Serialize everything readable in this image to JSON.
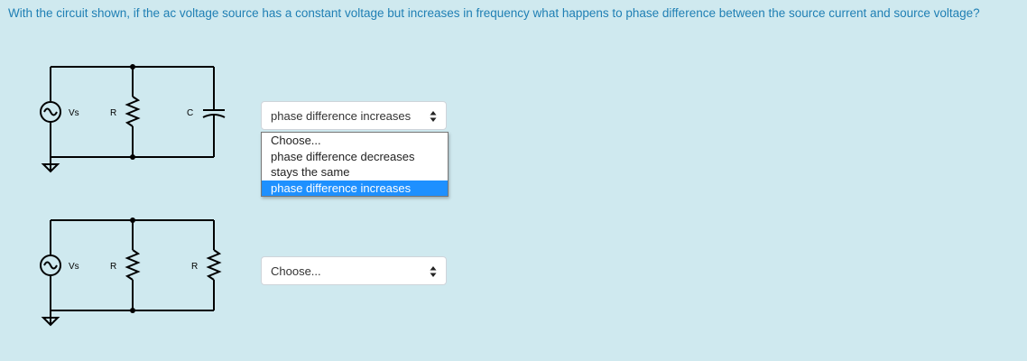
{
  "question": "With the circuit shown, if the ac voltage source has a constant voltage but increases in frequency what happens to phase difference between the source current and source voltage?",
  "circuit1": {
    "source_label": "Vs",
    "component1_label": "R",
    "component2_label": "C"
  },
  "circuit2": {
    "source_label": "Vs",
    "component1_label": "R",
    "component2_label": "R"
  },
  "select1": {
    "value": "phase difference increases",
    "options": [
      "Choose...",
      "phase difference decreases",
      "stays the same",
      "phase difference increases"
    ],
    "highlighted_index": 3
  },
  "select2": {
    "value": "Choose..."
  }
}
